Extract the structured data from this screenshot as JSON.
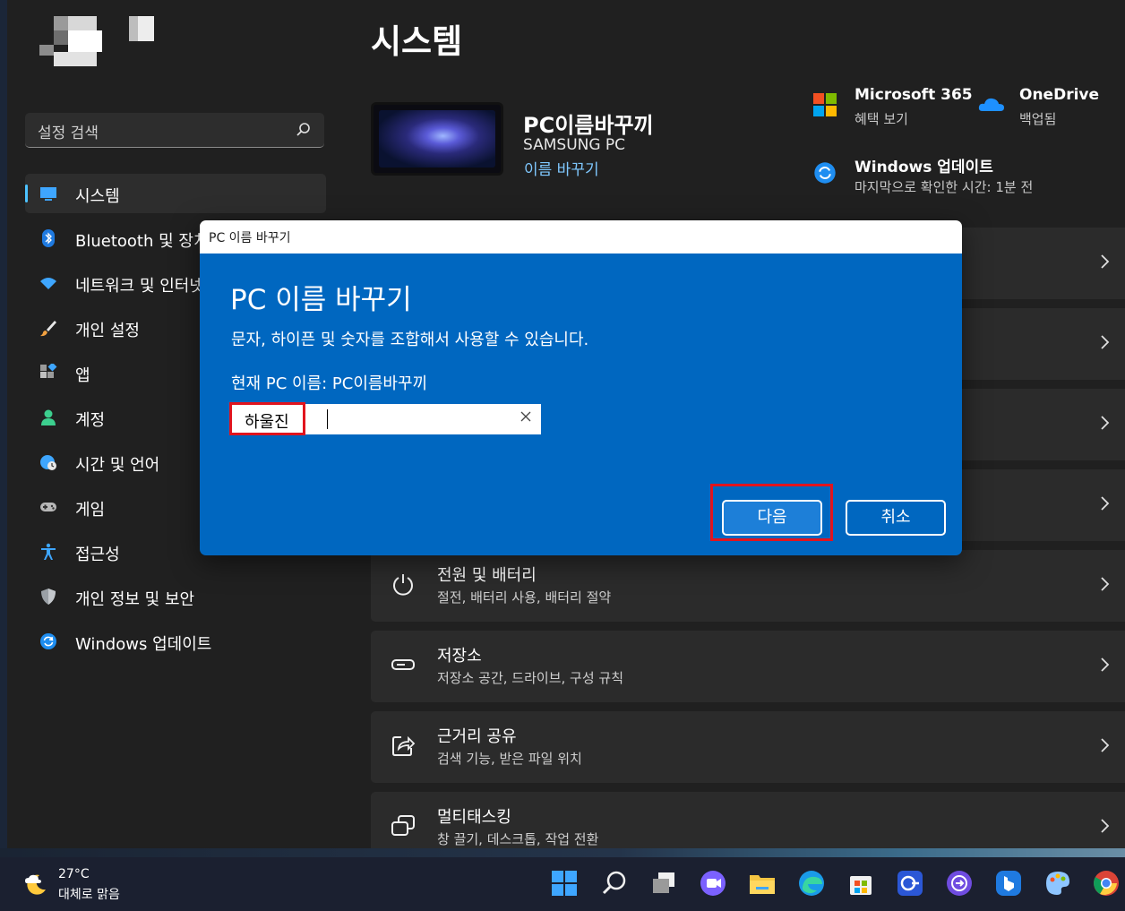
{
  "sidebar": {
    "search_placeholder": "설정 검색",
    "items": [
      {
        "label": "시스템",
        "active": true,
        "icon": "system-icon"
      },
      {
        "label": "Bluetooth 및 장치",
        "icon": "bluetooth-icon"
      },
      {
        "label": "네트워크 및 인터넷",
        "icon": "wifi-icon"
      },
      {
        "label": "개인 설정",
        "icon": "brush-icon"
      },
      {
        "label": "앱",
        "icon": "apps-icon"
      },
      {
        "label": "계정",
        "icon": "person-icon"
      },
      {
        "label": "시간 및 언어",
        "icon": "globe-clock-icon"
      },
      {
        "label": "게임",
        "icon": "gamepad-icon"
      },
      {
        "label": "접근성",
        "icon": "accessibility-icon"
      },
      {
        "label": "개인 정보 및 보안",
        "icon": "shield-icon"
      },
      {
        "label": "Windows 업데이트",
        "icon": "update-icon"
      }
    ]
  },
  "page": {
    "title": "시스템",
    "device": {
      "name": "PC이름바꾸끼",
      "model": "SAMSUNG PC",
      "rename_link": "이름 바꾸기"
    },
    "quick_links": [
      {
        "title": "Microsoft 365",
        "subtitle": "혜택 보기",
        "icon": "microsoft-logo-icon"
      },
      {
        "title": "OneDrive",
        "subtitle": "백업됨",
        "icon": "onedrive-icon"
      },
      {
        "title": "Windows 업데이트",
        "subtitle": "마지막으로 확인한 시간: 1분 전",
        "icon": "update-icon"
      }
    ],
    "cards": [
      {
        "title": "전원 및 배터리",
        "subtitle": "절전, 배터리 사용, 배터리 절약",
        "icon": "power-icon"
      },
      {
        "title": "저장소",
        "subtitle": "저장소 공간, 드라이브, 구성 규칙",
        "icon": "storage-icon"
      },
      {
        "title": "근거리 공유",
        "subtitle": "검색 기능, 받은 파일 위치",
        "icon": "share-icon"
      },
      {
        "title": "멀티태스킹",
        "subtitle": "창 끌기, 데스크톱, 작업 전환",
        "icon": "multitask-icon"
      }
    ]
  },
  "dialog": {
    "window_title": "PC 이름 바꾸기",
    "heading": "PC 이름 바꾸기",
    "description": "문자, 하이픈 및 숫자를 조합해서 사용할 수 있습니다.",
    "current_name": "현재 PC 이름: PC이름바꾸끼",
    "input_value": "하울진",
    "next_label": "다음",
    "cancel_label": "취소"
  },
  "taskbar": {
    "weather_temp": "27°C",
    "weather_desc": "대체로 맑음",
    "apps": [
      "windows-start-icon",
      "search-icon",
      "task-view-icon",
      "chat-icon",
      "file-explorer-icon",
      "edge-icon",
      "store-icon",
      "app-icon",
      "app-icon",
      "bing-icon",
      "paint-icon",
      "chrome-icon"
    ]
  },
  "colors": {
    "accent": "#0067c0",
    "highlight": "#e1141e",
    "link": "#7fc8ff"
  }
}
